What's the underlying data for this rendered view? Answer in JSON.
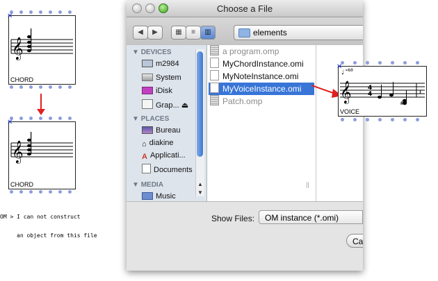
{
  "left_chord_box_top": {
    "label": "CHORD"
  },
  "left_chord_box_bottom": {
    "label": "CHORD"
  },
  "error_message": {
    "line1": "OM > I can not construct",
    "line2": "an object from this file"
  },
  "dialog": {
    "title": "Choose a File",
    "path_popup": "elements",
    "sidebar": {
      "devices_header": "DEVICES",
      "devices": [
        "m2984",
        "System",
        "iDisk",
        "Grap..."
      ],
      "places_header": "PLACES",
      "places": [
        "Bureau",
        "diakine",
        "Applicati...",
        "Documents"
      ],
      "media_header": "MEDIA",
      "media": [
        "Music"
      ]
    },
    "files": [
      {
        "name": "a program.omp",
        "state": "dimmed"
      },
      {
        "name": "MyChordInstance.omi",
        "state": "normal"
      },
      {
        "name": "MyNoteInstance.omi",
        "state": "normal"
      },
      {
        "name": "MyVoiceInstance.omi",
        "state": "selected"
      },
      {
        "name": "Patch.omp",
        "state": "dimmed"
      }
    ],
    "show_files_label": "Show Files:",
    "show_files_value": "OM instance (*.omi)",
    "cancel_label": "Ca"
  },
  "voice_box": {
    "label": "VOICE",
    "tempo": "=60"
  },
  "colors": {
    "selection": "#3875d7",
    "arrow": "#e02020",
    "inlet_dot": "#8c9ddc"
  }
}
